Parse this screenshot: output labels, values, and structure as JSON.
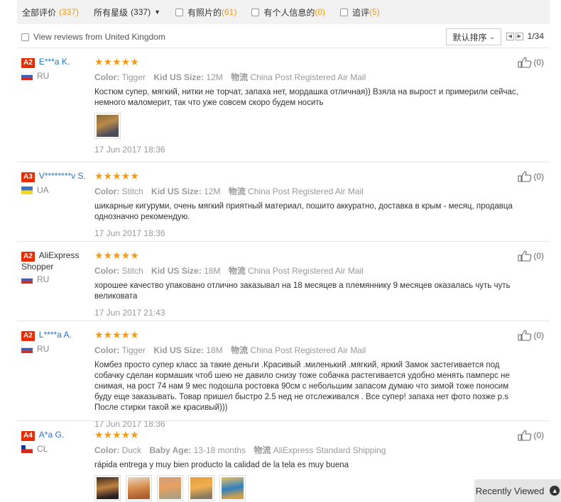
{
  "filters": {
    "all_label": "全部评价",
    "all_count": "(337)",
    "stars_label": "所有星级",
    "stars_count": "(337)",
    "photos_label": "有照片的",
    "photos_count": "(61)",
    "personal_label": "有个人信息的",
    "personal_count": "(0)",
    "followup_label": "追评",
    "followup_count": "(5)"
  },
  "subbar": {
    "view_uk_label": "View reviews from United Kingdom",
    "sort_label": "默认排序",
    "page_indicator": "1/34"
  },
  "reviews": [
    {
      "level": "A2",
      "name": "E***a K.",
      "country": "RU",
      "color_label": "Color:",
      "color": "Tigger",
      "size_label": "Kid US Size:",
      "size": "12M",
      "ship_label": "物流",
      "ship": "China Post Registered Air Mail",
      "text": "Костюм супер, мягкий, нитки не торчат, запаха нет, мордашка отличная)) Взяла на вырост и примерили сейчас, немного маломерит, так что уже совсем скоро будем носить",
      "date": "17 Jun 2017 18:36",
      "helpful": "(0)"
    },
    {
      "level": "A3",
      "name": "V********v S.",
      "country": "UA",
      "color_label": "Color:",
      "color": "Stitch",
      "size_label": "Kid US Size:",
      "size": "12M",
      "ship_label": "物流",
      "ship": "China Post Registered Air Mail",
      "text": "шикарные кигуруми, очень мягкий приятный материал, пошито аккуратно, доставка в крым - месяц, продавца однозначно рекомендую.",
      "date": "17 Jun 2017 18:36",
      "helpful": "(0)"
    },
    {
      "level": "A2",
      "name": "AliExpress Shopper",
      "country": "RU",
      "color_label": "Color:",
      "color": "Stitch",
      "size_label": "Kid US Size:",
      "size": "18M",
      "ship_label": "物流",
      "ship": "China Post Registered Air Mail",
      "text": "хорошее качество упаковано отлично заказывал на 18 месяцев а племяннику 9 месяцев оказалась чуть чуть великовата",
      "date": "17 Jun 2017 21:43",
      "helpful": "(0)"
    },
    {
      "level": "A2",
      "name": "L****a A.",
      "country": "RU",
      "color_label": "Color:",
      "color": "Tigger",
      "size_label": "Kid US Size:",
      "size": "18M",
      "ship_label": "物流",
      "ship": "China Post Registered Air Mail",
      "text": "Комбез просто супер класс за такие деньги .Красивый .миленький .мягкий, яркий Замок застегивается под собачку сделан кормашик чтоб шею не давило снизу тоже собачка растегивается удобно менять памперс не снимая, на рост 74 нам 9 мес подошла ростовка 90см с небольшим запасом думаю что зимой тоже поносим буду еще заказывать. Товар пришел быстро 2.5 нед не отслеживался . Все супер! запаха нет фото позже p.s После стирки такой же красивый)))",
      "date": "17 Jun 2017 18:36",
      "helpful": "(0)"
    },
    {
      "level": "A4",
      "name": "A*a G.",
      "country": "CL",
      "color_label": "Color:",
      "color": "Duck",
      "size_label": "Baby Age:",
      "size": "13-18 months",
      "ship_label": "物流",
      "ship": "AliExpress Standard Shipping",
      "text": "rápida entrega y muy bien producto la calidad de la tela es muy buena",
      "date": "",
      "helpful": "(0)"
    }
  ],
  "stars": "★★★★★",
  "recently_viewed": "Recently Viewed"
}
